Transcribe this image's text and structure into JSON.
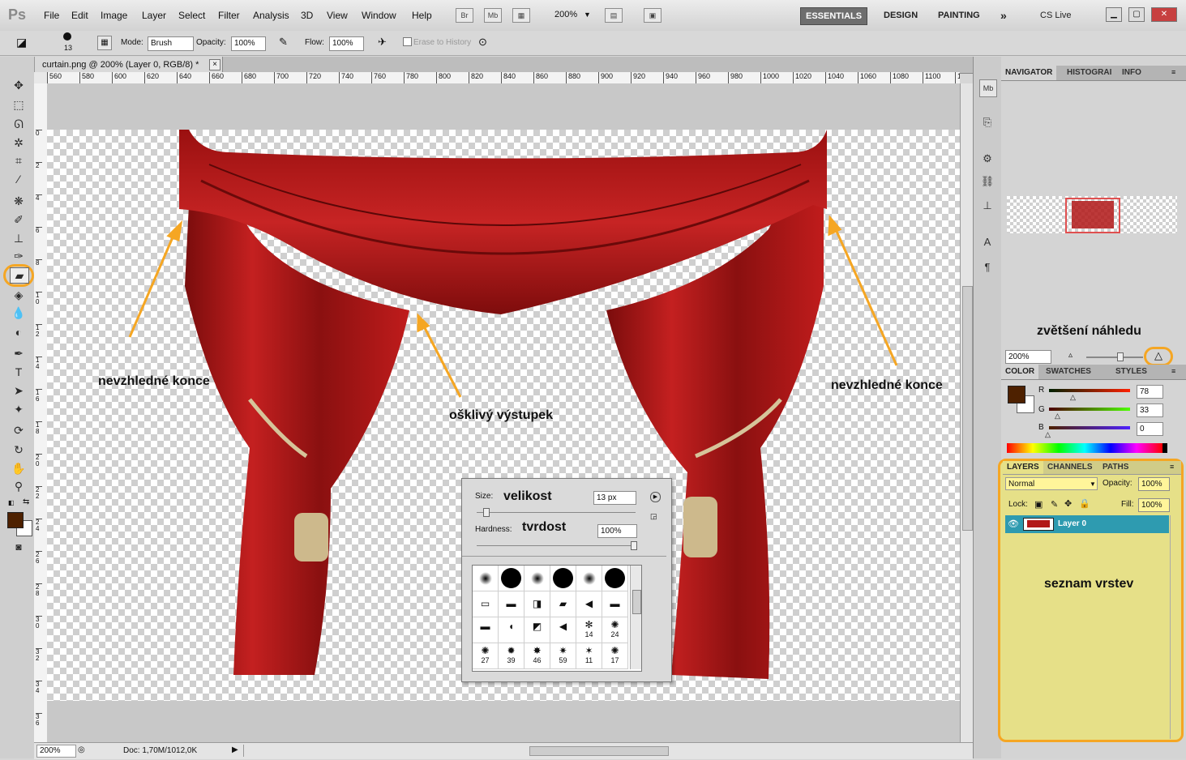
{
  "app": {
    "logo": "Ps"
  },
  "menu": [
    "File",
    "Edit",
    "Image",
    "Layer",
    "Select",
    "Filter",
    "Analysis",
    "3D",
    "View",
    "Window",
    "Help"
  ],
  "appbar": {
    "bridge": "Br",
    "minibridge": "Mb",
    "zoom": "200%"
  },
  "workspaces": {
    "essentials": "ESSENTIALS",
    "design": "DESIGN",
    "painting": "PAINTING",
    "more": "»",
    "cslive": "CS Live"
  },
  "options": {
    "brush_size": "13",
    "mode_label": "Mode:",
    "mode_value": "Brush",
    "opacity_label": "Opacity:",
    "opacity_value": "100%",
    "flow_label": "Flow:",
    "flow_value": "100%",
    "erase_history": "Erase to History"
  },
  "document": {
    "tab_title": "curtain.png @ 200% (Layer 0, RGB/8) *",
    "close": "×"
  },
  "ruler": {
    "h_ticks": [
      "560",
      "580",
      "600",
      "620",
      "640",
      "660",
      "680",
      "700",
      "720",
      "740",
      "760",
      "780",
      "800",
      "820",
      "840",
      "860",
      "880",
      "900",
      "920",
      "940",
      "960",
      "980",
      "1000",
      "1020",
      "1040",
      "1060",
      "1080",
      "1100",
      "1120"
    ],
    "v_ticks": [
      "0",
      "2",
      "4",
      "6",
      "8",
      "1 0",
      "1 2",
      "1 4",
      "1 6",
      "1 8",
      "2 0",
      "2 2",
      "2 4",
      "2 6",
      "2 8",
      "3 0",
      "3 2",
      "3 4",
      "3 6",
      "3 8"
    ]
  },
  "annotations": {
    "left_ends": "nevzhledné konce",
    "right_ends": "nevzhledné konce",
    "bump": "ošklivý výstupek",
    "preview_zoom": "zvětšení náhledu",
    "layers_list": "seznam vrstev"
  },
  "brush_popup": {
    "size_label": "Size:",
    "size_note": "velikost",
    "size_value": "13 px",
    "hardness_label": "Hardness:",
    "hardness_note": "tvrdost",
    "hardness_value": "100%",
    "presets_row3": [
      "",
      "",
      "",
      "",
      "14",
      "24"
    ],
    "presets_row4": [
      "27",
      "39",
      "46",
      "59",
      "11",
      "17"
    ]
  },
  "status": {
    "zoom": "200%",
    "doc": "Doc: 1,70M/1012,0K"
  },
  "navigator": {
    "tabs": [
      "NAVIGATOR",
      "HISTOGRAI",
      "INFO"
    ],
    "zoom": "200%"
  },
  "color_panel": {
    "tabs": [
      "COLOR",
      "SWATCHES",
      "STYLES"
    ],
    "r_label": "R",
    "r_value": "78",
    "g_label": "G",
    "g_value": "33",
    "b_label": "B",
    "b_value": "0",
    "foreground": "#4e2100"
  },
  "layers_panel": {
    "tabs": [
      "LAYERS",
      "CHANNELS",
      "PATHS"
    ],
    "blend_mode": "Normal",
    "opacity_label": "Opacity:",
    "opacity_value": "100%",
    "lock_label": "Lock:",
    "fill_label": "Fill:",
    "fill_value": "100%",
    "layers": [
      {
        "name": "Layer 0",
        "visible": true
      }
    ]
  },
  "colors": {
    "highlight": "#f5a623",
    "layer_selected": "#2e9bb0",
    "panel_highlight_bg": "#e6e088",
    "curtain": "#b21818"
  }
}
